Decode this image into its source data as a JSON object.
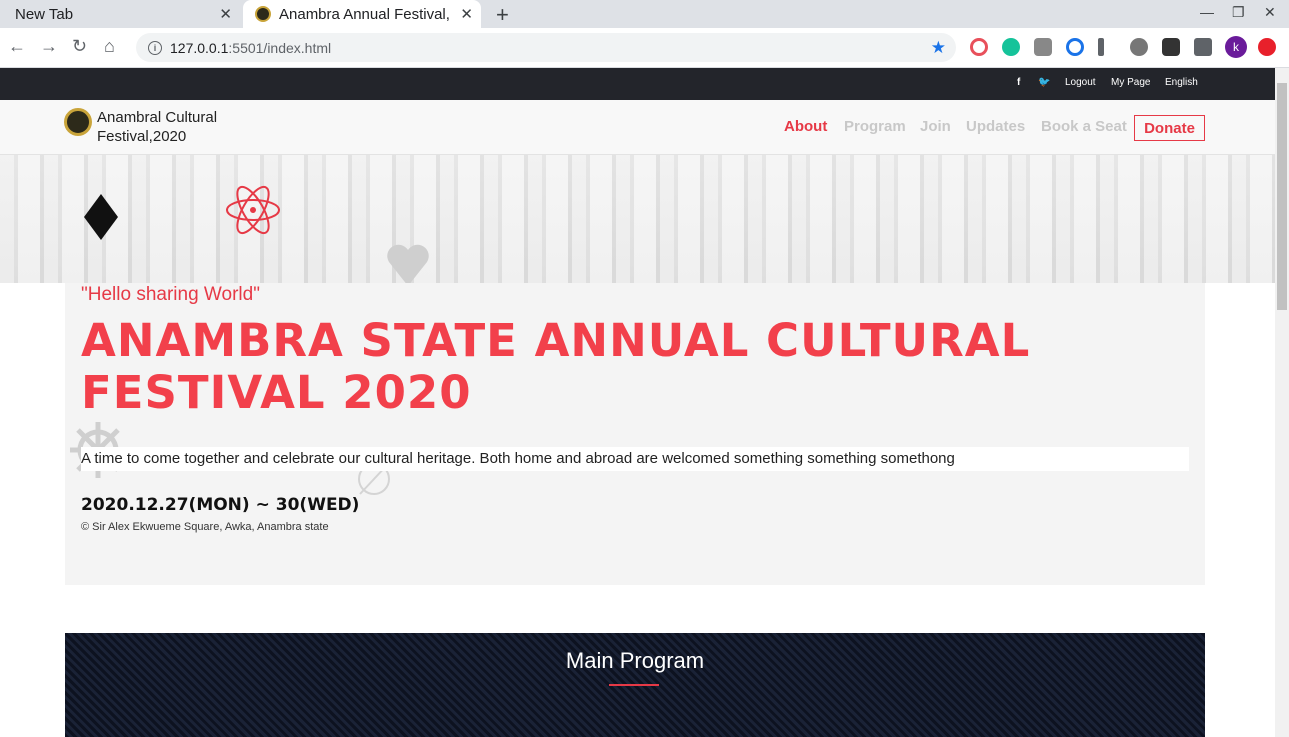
{
  "browser": {
    "tabs": [
      {
        "label": "New Tab"
      },
      {
        "label": "Anambra Annual Festival,"
      }
    ],
    "url_host": "127.0.0.1",
    "url_path": ":5501/index.html",
    "close_glyph": "✕",
    "newtab_glyph": "+"
  },
  "topbar": {
    "facebook": "f",
    "twitter": "🐦",
    "links": [
      "Logout",
      "My Page",
      "English"
    ]
  },
  "header": {
    "brand": "Anambral Cultural Festival,2020",
    "nav": [
      "About",
      "Program",
      "Join",
      "Updates",
      "Book a Seat"
    ],
    "donate": "Donate",
    "active_color": "#e63946"
  },
  "hero": {
    "quote": "\"Hello sharing World\"",
    "title": "ANAMBRA STATE ANNUAL CULTURAL FESTIVAL 2020",
    "description": "A time to come together and celebrate our cultural heritage. Both home and abroad are welcomed something something somethong",
    "date": "2020.12.27(MON) ~ 30(WED)",
    "venue": "© Sir Alex Ekwueme Square, Awka, Anambra state"
  },
  "program": {
    "title": "Main Program"
  }
}
